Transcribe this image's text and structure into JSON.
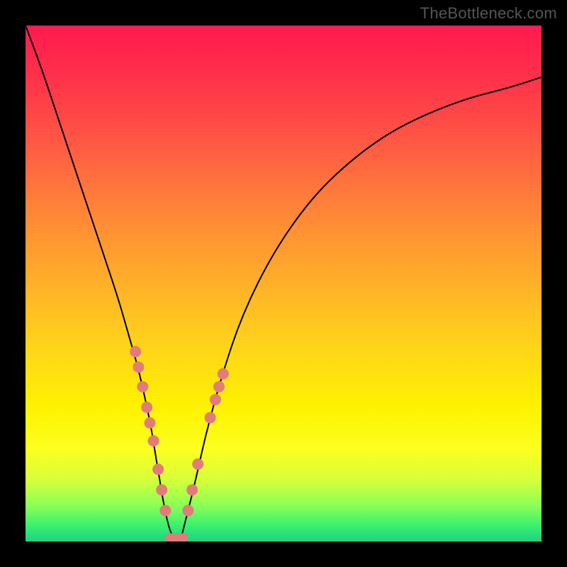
{
  "watermark": "TheBottleneck.com",
  "chart_data": {
    "type": "line",
    "title": "",
    "xlabel": "",
    "ylabel": "",
    "xlim": [
      0,
      100
    ],
    "ylim": [
      0,
      100
    ],
    "x_percent": [
      0,
      3,
      6,
      9,
      12,
      15,
      18,
      20,
      22,
      24,
      25,
      26,
      27,
      28,
      29,
      30,
      31,
      33,
      35,
      38,
      42,
      48,
      55,
      62,
      70,
      78,
      86,
      94,
      100
    ],
    "y_percent": [
      100,
      92,
      83,
      74,
      65,
      56,
      47,
      40,
      33,
      24,
      18,
      12,
      6,
      2,
      0,
      0,
      4,
      12,
      21,
      32,
      44,
      56,
      66,
      73,
      79,
      83,
      86,
      88,
      90
    ],
    "markers_left": [
      {
        "x_pct": 21.3,
        "y_pct": 36.8
      },
      {
        "x_pct": 21.9,
        "y_pct": 33.8
      },
      {
        "x_pct": 22.7,
        "y_pct": 30.0
      },
      {
        "x_pct": 23.5,
        "y_pct": 26.0
      },
      {
        "x_pct": 24.1,
        "y_pct": 23.0
      },
      {
        "x_pct": 24.8,
        "y_pct": 19.5
      },
      {
        "x_pct": 25.7,
        "y_pct": 14.0
      },
      {
        "x_pct": 26.4,
        "y_pct": 10.0
      },
      {
        "x_pct": 27.1,
        "y_pct": 6.0
      }
    ],
    "markers_right": [
      {
        "x_pct": 31.5,
        "y_pct": 6.0
      },
      {
        "x_pct": 32.3,
        "y_pct": 10.0
      },
      {
        "x_pct": 33.4,
        "y_pct": 15.0
      },
      {
        "x_pct": 35.8,
        "y_pct": 24.0
      },
      {
        "x_pct": 36.8,
        "y_pct": 27.5
      },
      {
        "x_pct": 37.5,
        "y_pct": 30.0
      },
      {
        "x_pct": 38.3,
        "y_pct": 32.5
      }
    ],
    "bottom_bar": {
      "x_start_pct": 27.0,
      "x_end_pct": 31.5,
      "height_pct": 1.6
    },
    "colors": {
      "gradient_top": "#ff1a4f",
      "gradient_mid": "#ffd31a",
      "gradient_bottom": "#1fd085",
      "curve": "#000000",
      "marker": "#e37b7b",
      "frame": "#000000"
    }
  }
}
